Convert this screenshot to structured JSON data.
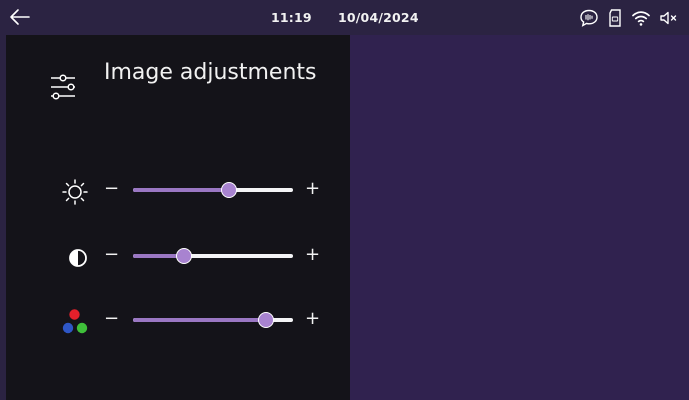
{
  "status_bar": {
    "time": "11:19",
    "date": "10/04/2024",
    "icons": [
      "back-arrow-icon",
      "speech-bubble-icon",
      "sd-card-icon",
      "wifi-icon",
      "speaker-muted-icon"
    ]
  },
  "panel": {
    "title": "Image adjustments",
    "title_icon": "sliders-icon"
  },
  "adjustments": [
    {
      "name": "brightness",
      "icon": "brightness-icon",
      "minus": "−",
      "plus": "+",
      "level": 0.6
    },
    {
      "name": "contrast",
      "icon": "contrast-icon",
      "minus": "−",
      "plus": "+",
      "level": 0.32
    },
    {
      "name": "color",
      "icon": "color-dots-icon",
      "minus": "−",
      "plus": "+",
      "level": 0.83
    }
  ],
  "colors": {
    "status_bar": "#2b2342",
    "panel_bg": "#141319",
    "preview_bg": "#30224f",
    "slider_fill": "#9a77c3",
    "slider_thumb": "#a883d0",
    "track": "#f4f4f6"
  }
}
